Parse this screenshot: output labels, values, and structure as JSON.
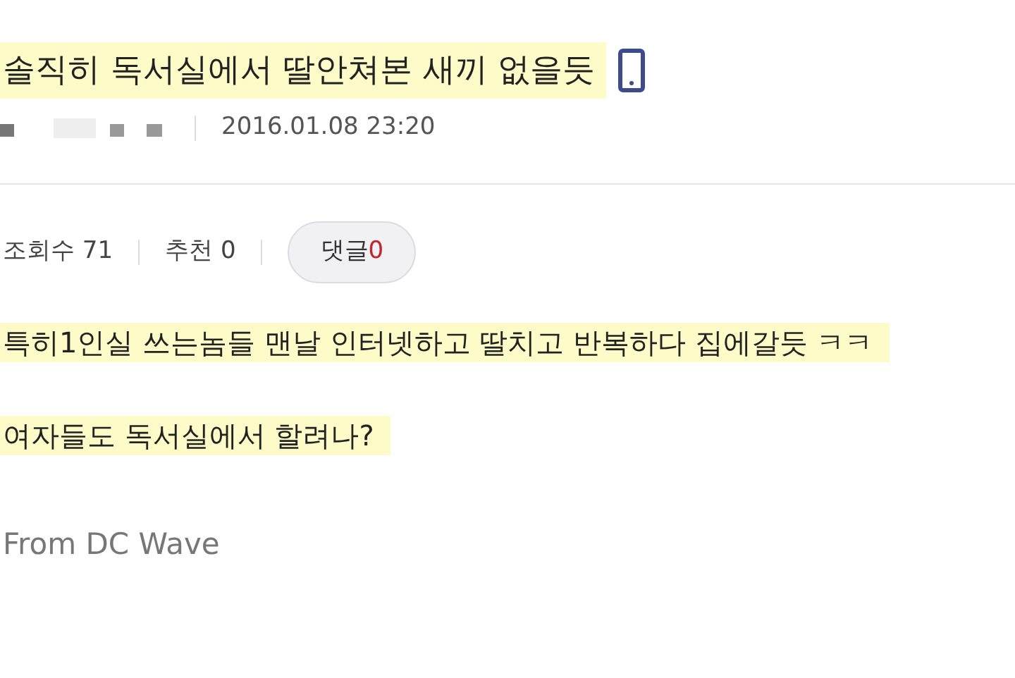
{
  "post": {
    "title": "솔직히 독서실에서 딸안쳐본 새끼 없을듯",
    "title_highlighted": true,
    "mobile": true,
    "date": "2016.01.08 23:20"
  },
  "stats": {
    "views_label": "조회수 71",
    "likes_label": "추천 0",
    "comments_label": "댓글",
    "comments_count": "0"
  },
  "body": [
    {
      "text": "특히1인실 쓰는놈들 맨날 인터넷하고 딸치고 반복하다 집에갈듯 ㅋㅋ",
      "highlighted": true
    },
    {
      "text": "여자들도 독서실에서 할려나?",
      "highlighted": true
    }
  ],
  "footer": "From DC Wave"
}
